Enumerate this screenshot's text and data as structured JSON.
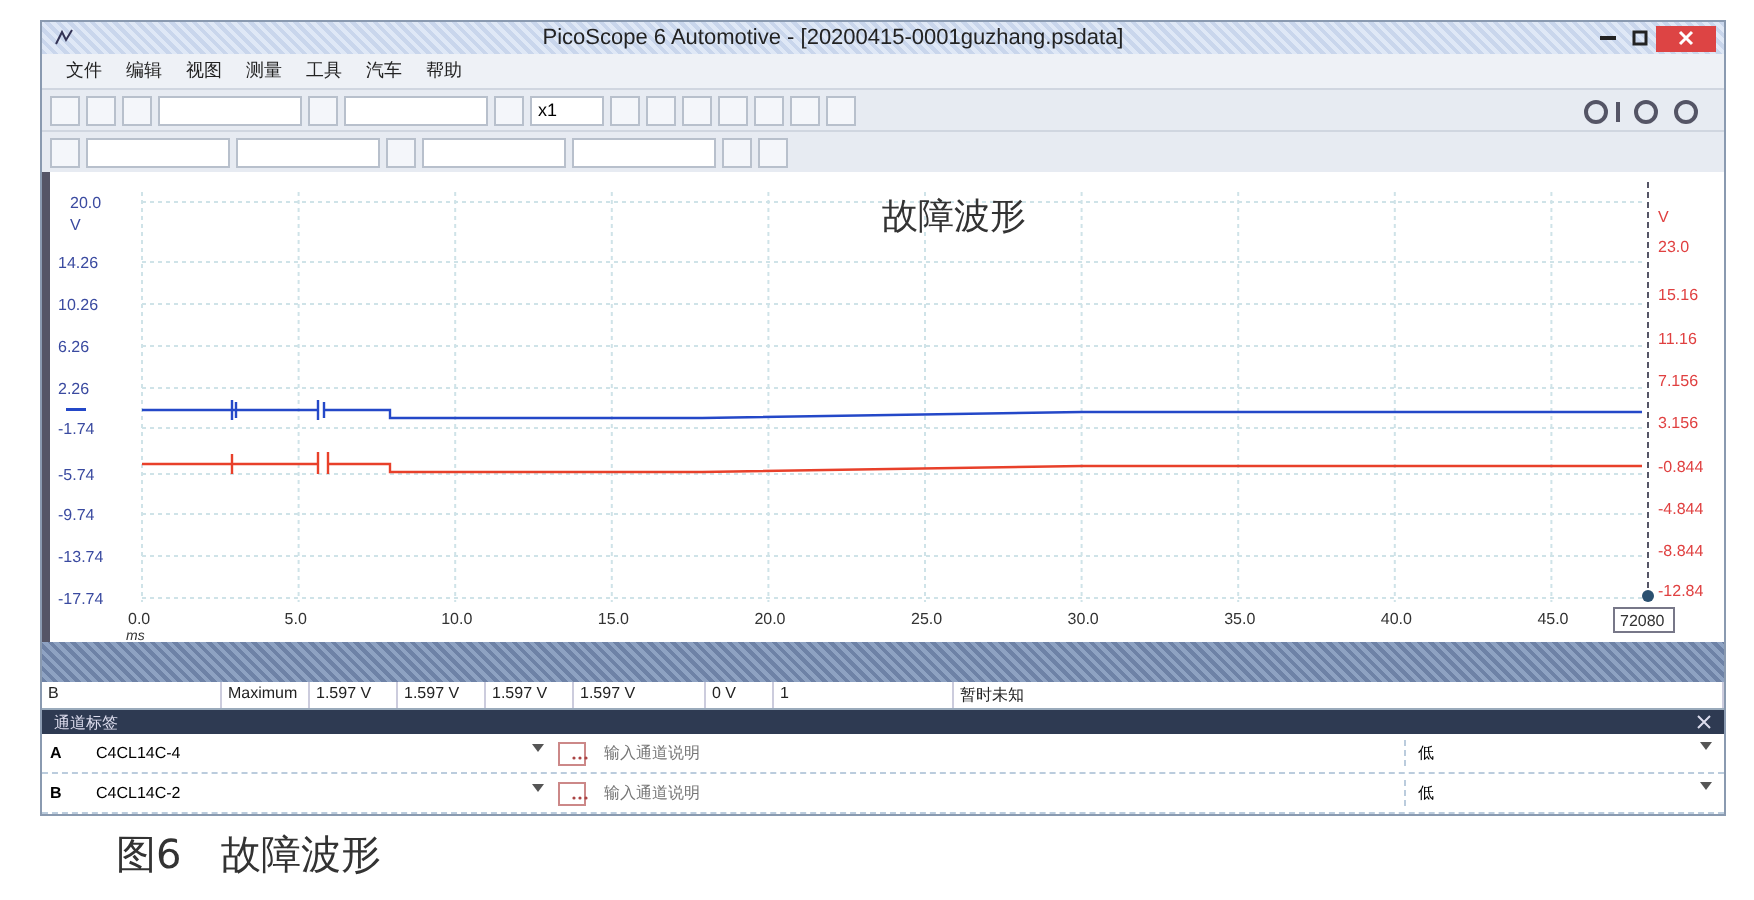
{
  "window": {
    "title": "PicoScope 6 Automotive - [20200415-0001guzhang.psdata]"
  },
  "menu": [
    "文件",
    "编辑",
    "视图",
    "测量",
    "工具",
    "汽车",
    "帮助"
  ],
  "toolbar": {
    "zoom_factor": "x1"
  },
  "chart": {
    "title": "故障波形",
    "left_ticks": [
      "20.0",
      "14.26",
      "10.26",
      "6.26",
      "2.26",
      "-1.74",
      "-5.74",
      "-9.74",
      "-13.74",
      "-17.74"
    ],
    "left_unit": "V",
    "right_unit": "V",
    "right_ticks": [
      "23.0",
      "15.16",
      "11.16",
      "7.156",
      "3.156",
      "-0.844",
      "-4.844",
      "-8.844",
      "-12.84"
    ],
    "x_ticks": [
      "0.0",
      "5.0",
      "10.0",
      "15.0",
      "20.0",
      "25.0",
      "30.0",
      "35.0",
      "40.0",
      "45.0"
    ],
    "x_unit": "ms",
    "ruler_value": "72080",
    "channels": [
      {
        "color": "#2448c8"
      },
      {
        "color": "#e8402a"
      }
    ]
  },
  "measurements": {
    "rows": [
      {
        "channel": "B",
        "name": "Maximum",
        "value": "1.597 V",
        "min": "1.597 V",
        "max": "1.597 V",
        "average": "1.597 V",
        "sd": "0 V",
        "count": "1",
        "note": "暂时未知"
      }
    ]
  },
  "channel_labels": {
    "title": "通道标签",
    "rows": [
      {
        "channel": "A",
        "probe": "C4CL14C-4",
        "placeholder": "输入通道说明",
        "level": "低"
      },
      {
        "channel": "B",
        "probe": "C4CL14C-2",
        "placeholder": "输入通道说明",
        "level": "低"
      }
    ]
  },
  "caption": "图6　故障波形"
}
